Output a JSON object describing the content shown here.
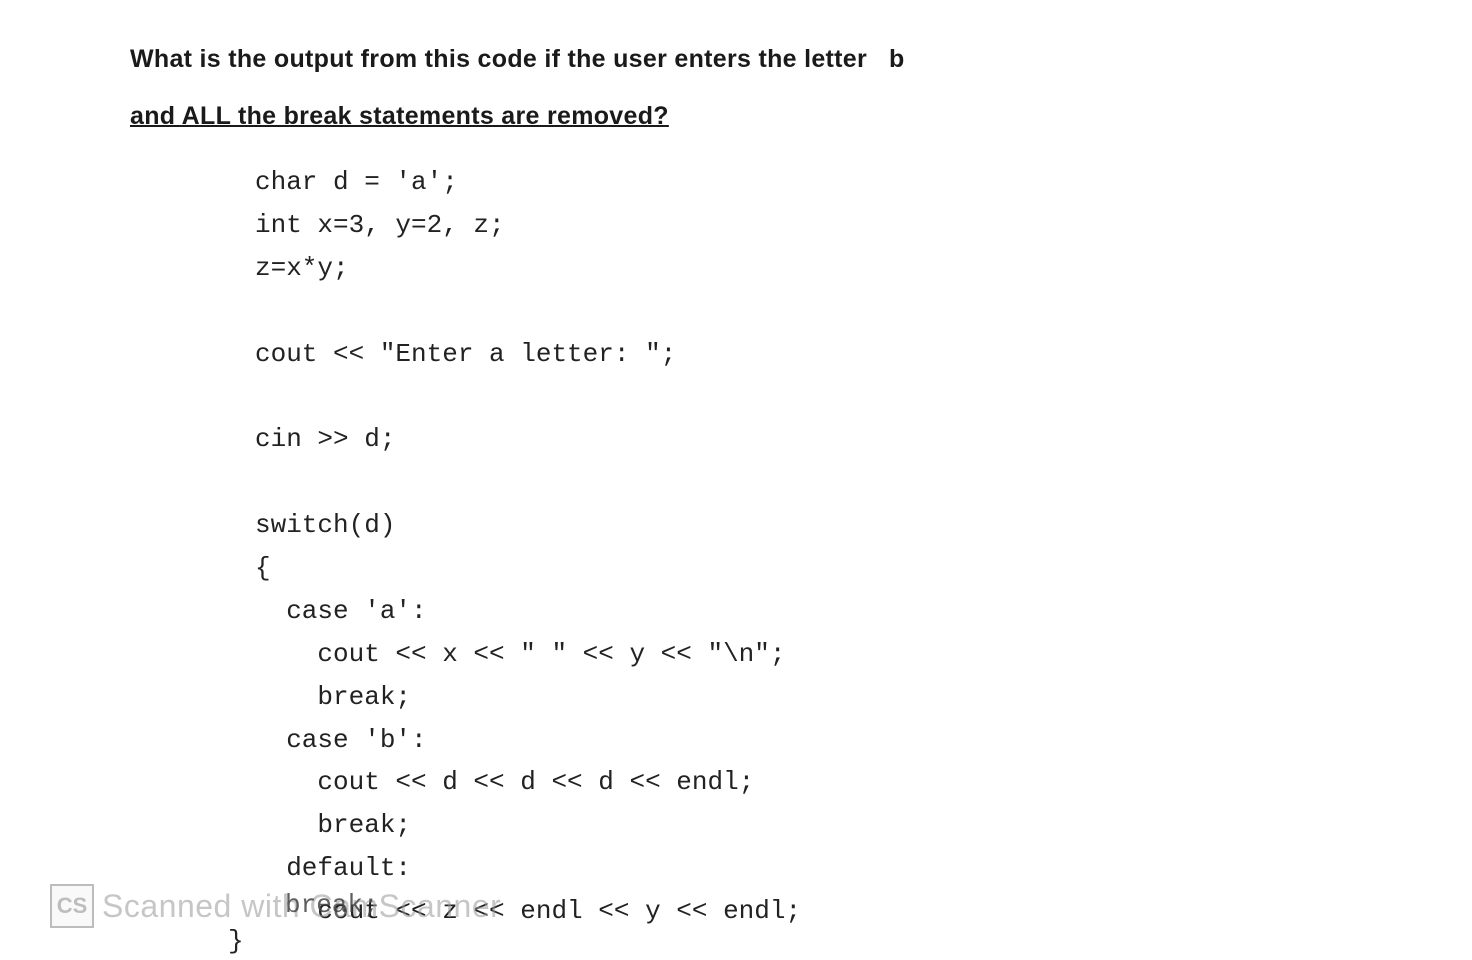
{
  "question": {
    "line1_part1": "What is the output from this code if the user enters the letter",
    "line1_part2": "b",
    "line2": "and ALL the break statements are removed?"
  },
  "code": {
    "l1": "char d = 'a';",
    "l2": "int x=3, y=2, z;",
    "l3": "z=x*y;",
    "l4": "",
    "l5": "cout << \"Enter a letter: \";",
    "l6": "",
    "l7": "cin >> d;",
    "l8": "",
    "l9": "switch(d)",
    "l10": "{",
    "l11": "  case 'a':",
    "l12": "    cout << x << \" \" << y << \"\\n\";",
    "l13": "    break;",
    "l14": "  case 'b':",
    "l15": "    cout << d << d << d << endl;",
    "l16": "    break;",
    "l17": "  default:",
    "l18": "    cout << z << endl << y << endl;",
    "l19_overlay": "break;",
    "l20": "}"
  },
  "watermark": {
    "icon": "CS",
    "text": "Scanned with CamScanner"
  }
}
